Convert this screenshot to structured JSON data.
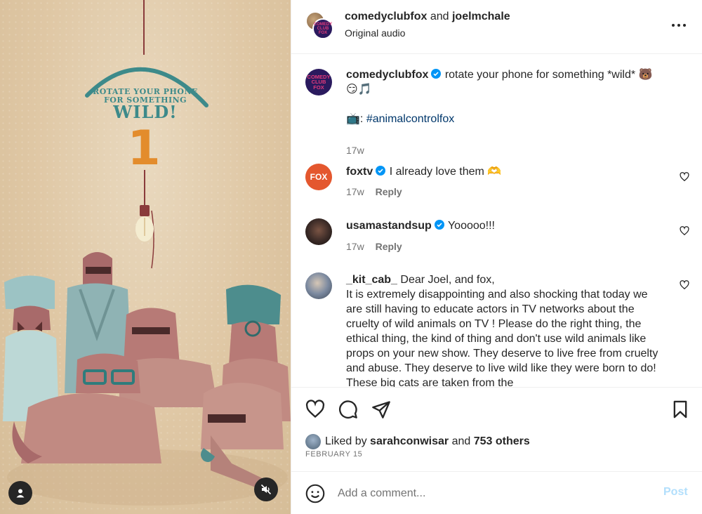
{
  "media": {
    "promo_line1": "ROTATE YOUR PHONE",
    "promo_line2": "FOR SOMETHING",
    "promo_wild": "WILD!",
    "promo_number": "1",
    "user_tag_icon": "user-icon",
    "mute_icon": "speaker-muted-icon"
  },
  "header": {
    "user1": "comedyclubfox",
    "and_text": "and",
    "user2": "joelmchale",
    "audio": "Original audio",
    "avatar_logo_line1": "COMEDY",
    "avatar_logo_line2": "CLUB",
    "avatar_logo_line3": "FOX"
  },
  "caption": {
    "username": "comedyclubfox",
    "text": "rotate your phone for something *wild* 🐻",
    "text2": "😏🎵",
    "prefix_emoji": "📺:",
    "hashtag": "#animalcontrolfox",
    "time": "17w",
    "avatar_logo_line1": "COMEDY",
    "avatar_logo_line2": "CLUB",
    "avatar_logo_line3": "FOX"
  },
  "comments": [
    {
      "username": "foxtv",
      "text": "I already love them 🫶",
      "time": "17w",
      "reply": "Reply",
      "avatar_text": "FOX"
    },
    {
      "username": "usamastandsup",
      "text": "Yooooo!!!",
      "time": "17w",
      "reply": "Reply"
    },
    {
      "username": "_kit_cab_",
      "text_line1": "Dear Joel, and fox,",
      "text_rest": "It is extremely disappointing and also shocking that today we are still having to educate actors in TV networks about the cruelty of wild animals on TV ! Please do the right thing, the ethical thing, the kind of thing and don't use wild animals like props on your new show. They deserve to live free from cruelty and abuse. They deserve to live wild like they were born to do! These big cats are taken from the"
    }
  ],
  "actions": {
    "like_icon": "heart-icon",
    "comment_icon": "comment-icon",
    "share_icon": "send-icon",
    "save_icon": "bookmark-icon"
  },
  "likes": {
    "prefix": "Liked by",
    "user": "sarahconwisar",
    "and": "and",
    "others": "753 others"
  },
  "date": "FEBRUARY 15",
  "comment_box": {
    "placeholder": "Add a comment...",
    "post_label": "Post",
    "emoji_icon": "smiley-icon"
  },
  "colors": {
    "verified_blue": "#0095f6",
    "post_disabled": "#b2dffc",
    "hashtag": "#00376b",
    "fox_orange": "#e4572e",
    "promo_teal": "#3d8a8a",
    "promo_orange": "#e38c2c"
  }
}
